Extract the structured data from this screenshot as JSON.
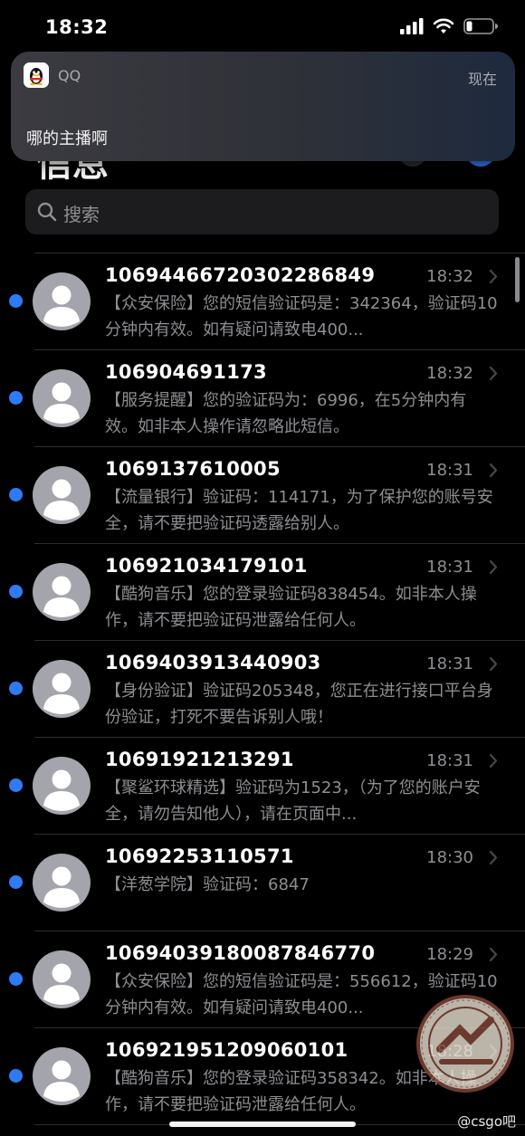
{
  "status_bar": {
    "time": "18:32",
    "icons": [
      "signal-icon",
      "wifi-icon",
      "battery-icon"
    ]
  },
  "header": {
    "title": "信息"
  },
  "notification": {
    "app_name": "QQ",
    "time": "现在",
    "body": "哪的主播啊",
    "icon": "qq-penguin-icon"
  },
  "search": {
    "placeholder": "搜索"
  },
  "colors": {
    "background": "#000000",
    "unread_dot": "#2f7bf6",
    "secondary_text": "#8e8e93",
    "search_bg": "#1c1c1e"
  },
  "messages": [
    {
      "sender": "106944667203022868​49",
      "time": "18:32",
      "preview": "【众安保险】您的短信验证码是：342364，验证码10分钟内有效。如有疑问请致电400...",
      "unread": true
    },
    {
      "sender": "106904691173",
      "time": "18:32",
      "preview": "【服务提醒】您的验证码为：6996，在5分钟内有效。如非本人操作请忽略此短信。",
      "unread": true
    },
    {
      "sender": "1069137610005",
      "time": "18:31",
      "preview": "【流量银行】验证码：114171，为了保护您的账号安全，请不要把验证码透露给别人。",
      "unread": true
    },
    {
      "sender": "106921034179101",
      "time": "18:31",
      "preview": "【酷狗音乐】您的登录验证码838454。如非本人操作，请不要把验证码泄露给任何人。",
      "unread": true
    },
    {
      "sender": "1069403913440903",
      "time": "18:31",
      "preview": "【身份验证】验证码205348，您正在进行接口平台身份验证，打死不要告诉别人哦！",
      "unread": true
    },
    {
      "sender": "10691921213291",
      "time": "18:31",
      "preview": "【聚鲨环球精选】验证码为1523，（为了您的账户安全，请勿告知他人），请在页面中...",
      "unread": true
    },
    {
      "sender": "10692253110571",
      "time": "18:30",
      "preview": "【洋葱学院】验证码：6847",
      "unread": true
    },
    {
      "sender": "10694039180087846770",
      "time": "18:29",
      "preview": "【众安保险】您的短信验证码是：556612，验证码10分钟内有效。如有疑问请致电400...",
      "unread": true
    },
    {
      "sender": "106921951209060101",
      "time": "18:28",
      "preview": "【酷狗音乐】您的登录验证码358342。如非本人操作，请不要把验证码泄露给任何人。",
      "unread": true
    }
  ],
  "watermark": {
    "text": "@csgo吧"
  }
}
